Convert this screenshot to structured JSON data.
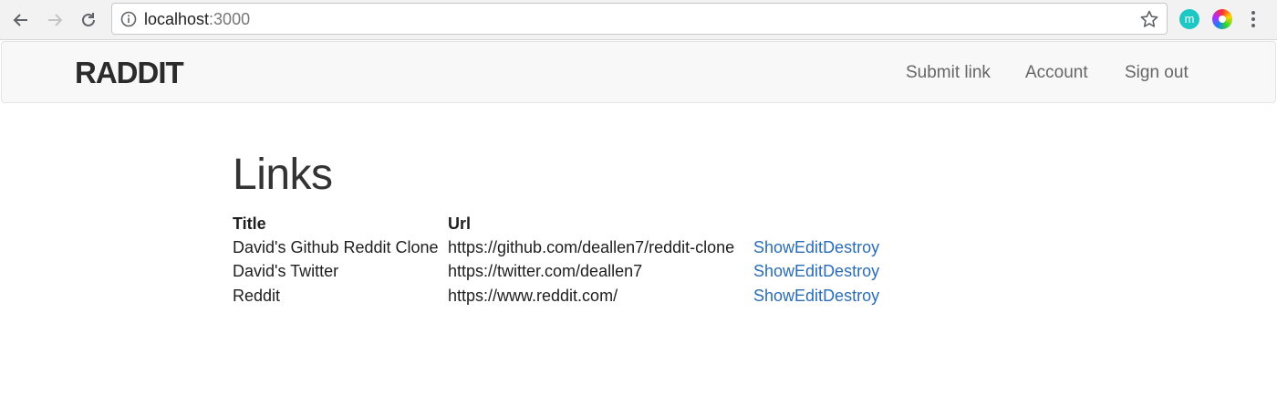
{
  "browser": {
    "url_host": "localhost",
    "url_port": ":3000",
    "extensions": [
      {
        "name": "m-extension",
        "label": "m"
      },
      {
        "name": "color-wheel-extension",
        "label": ""
      }
    ]
  },
  "navbar": {
    "brand": "RADDIT",
    "links": [
      "Submit link",
      "Account",
      "Sign out"
    ]
  },
  "main": {
    "title": "Links",
    "table": {
      "headers": [
        "Title",
        "Url",
        ""
      ],
      "rows": [
        {
          "title": "David's Github Reddit Clone",
          "url": "https://github.com/deallen7/reddit-clone",
          "actions": [
            "Show",
            "Edit",
            "Destroy"
          ]
        },
        {
          "title": "David's Twitter",
          "url": "https://twitter.com/deallen7",
          "actions": [
            "Show",
            "Edit",
            "Destroy"
          ]
        },
        {
          "title": "Reddit",
          "url": "https://www.reddit.com/",
          "actions": [
            "Show",
            "Edit",
            "Destroy"
          ]
        }
      ]
    }
  },
  "colors": {
    "link": "#2a6db5",
    "navbar_bg": "#f8f8f8",
    "brand": "#2b2b2b"
  }
}
